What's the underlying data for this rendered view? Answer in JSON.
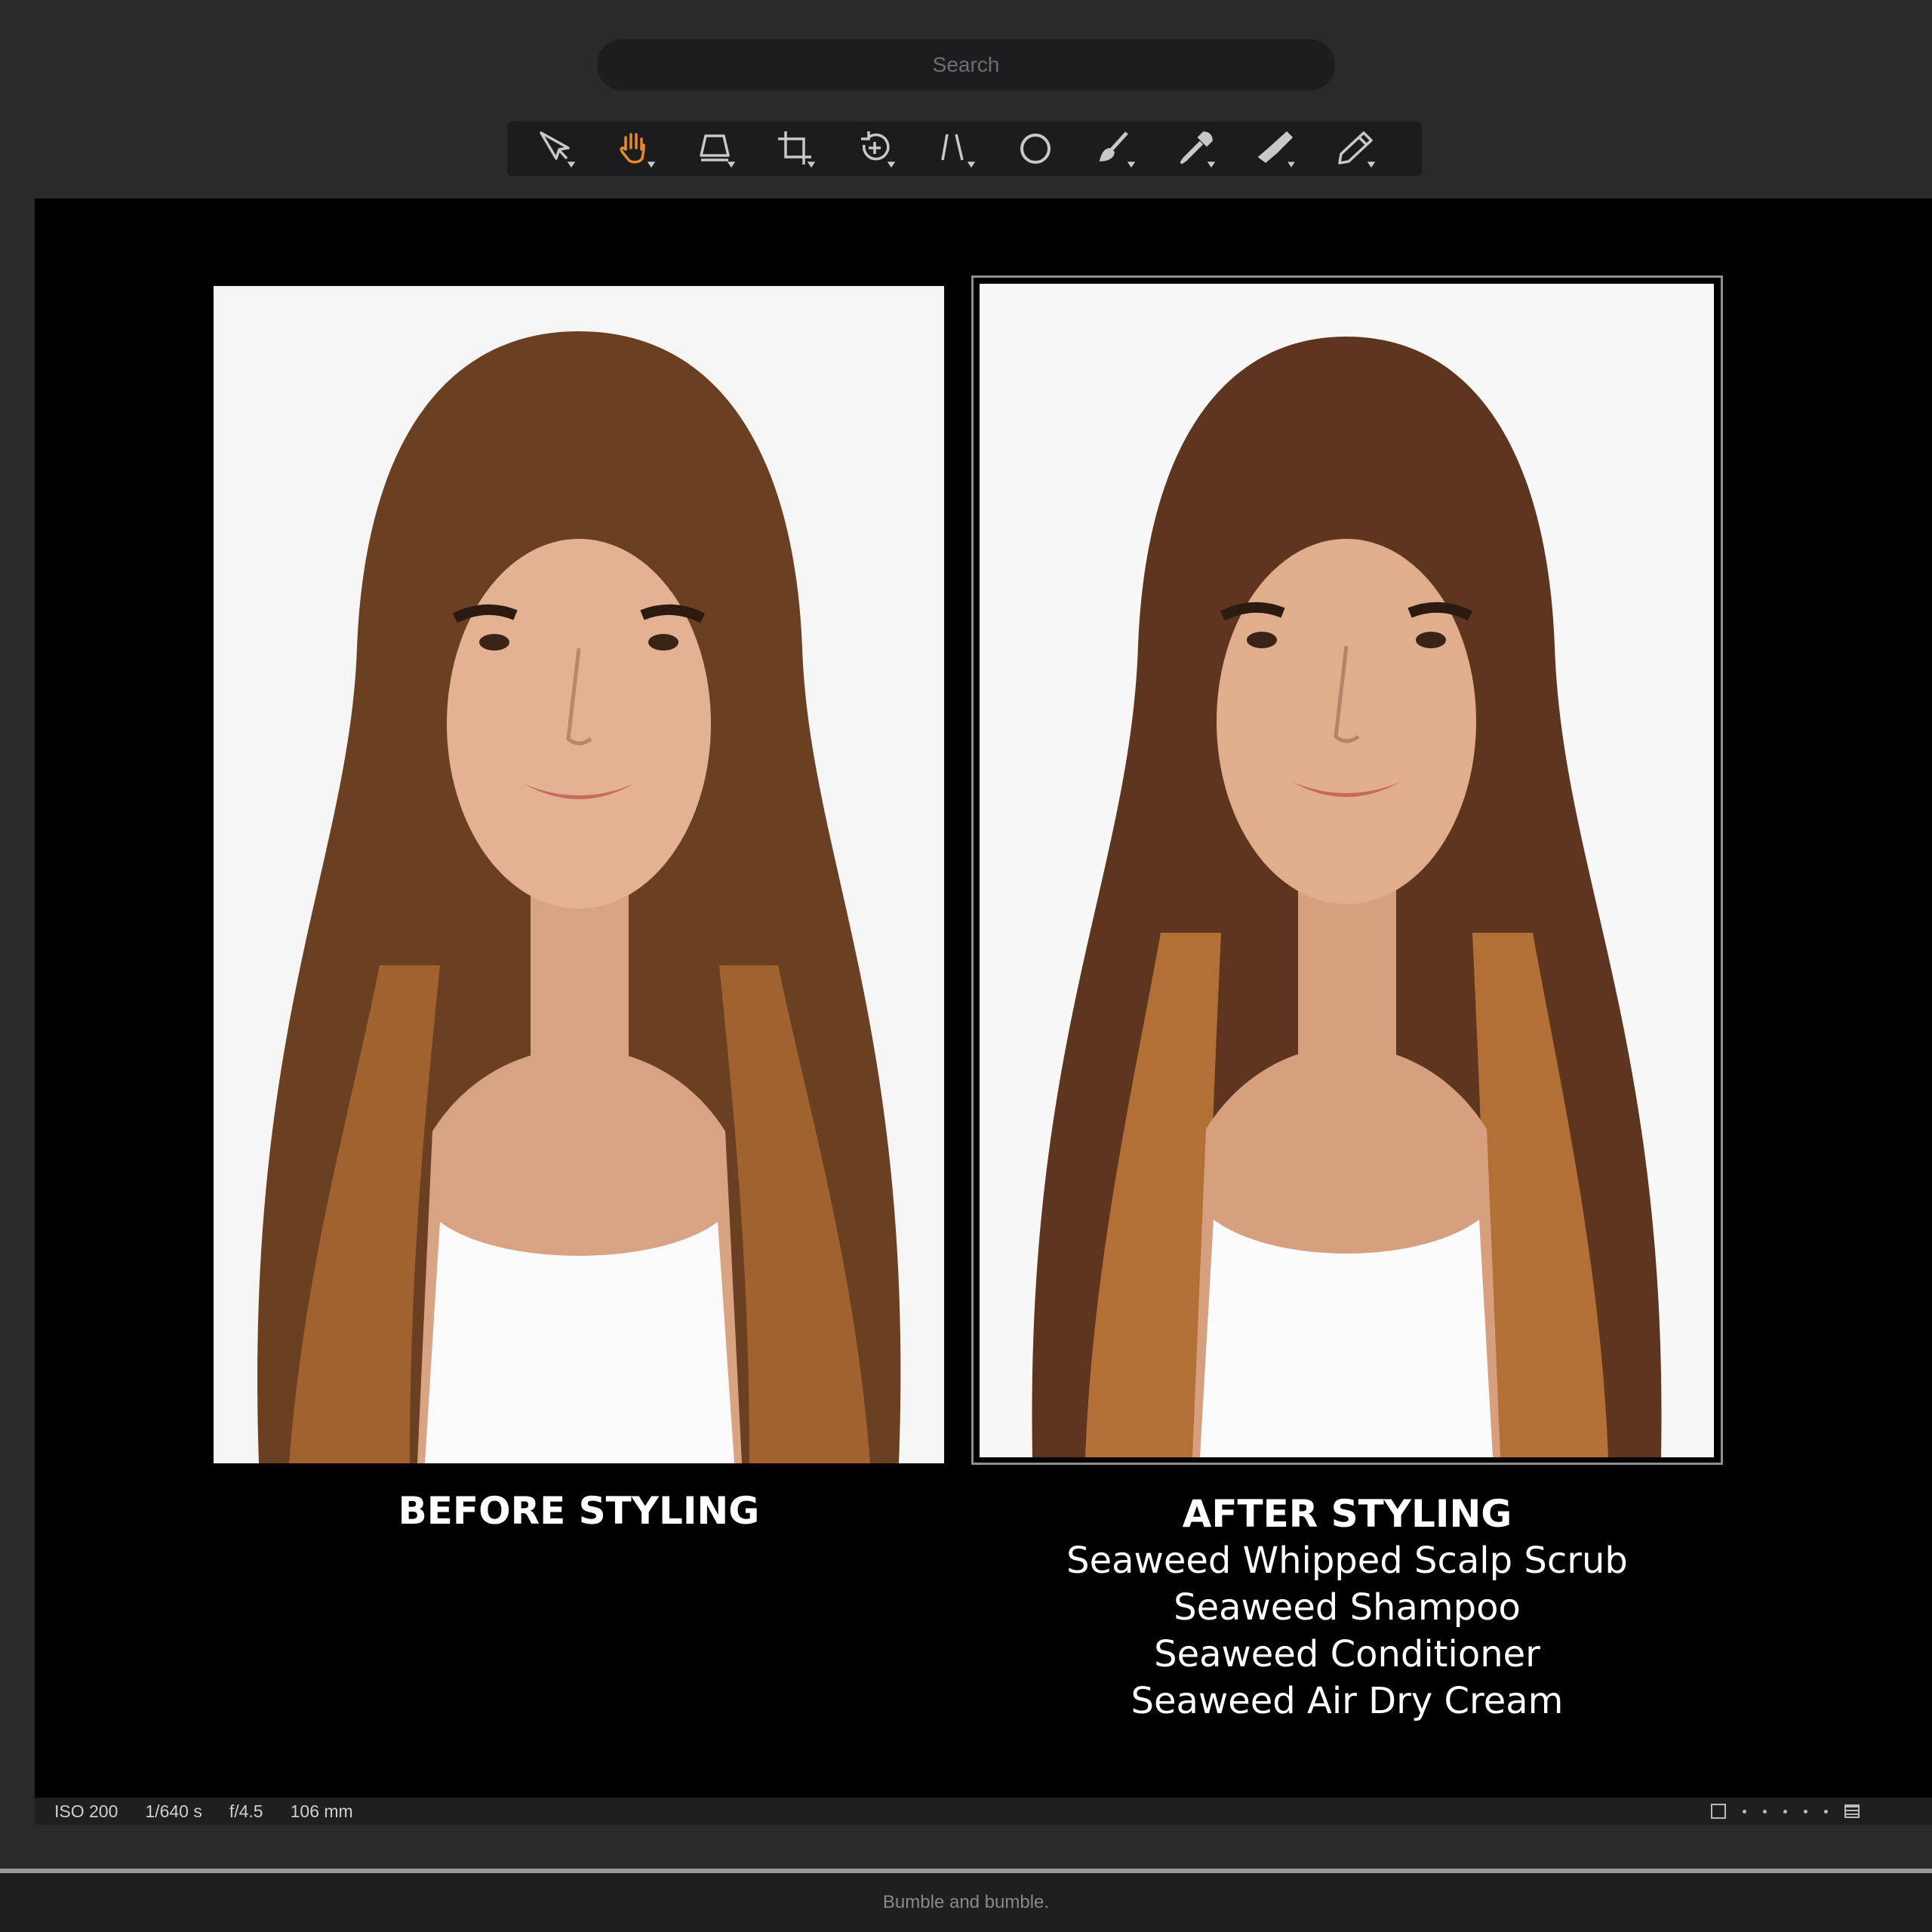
{
  "search": {
    "placeholder": "Search"
  },
  "toolbar": {
    "tools": [
      {
        "icon": "select-arrow-icon",
        "active": false
      },
      {
        "icon": "hand-pan-icon",
        "active": true
      },
      {
        "icon": "perspective-icon",
        "active": false
      },
      {
        "icon": "crop-icon",
        "active": false
      },
      {
        "icon": "rotate-icon",
        "active": false
      },
      {
        "icon": "straighten-icon",
        "active": false
      },
      {
        "icon": "circle-icon",
        "active": false
      },
      {
        "icon": "brush-icon",
        "active": false
      },
      {
        "icon": "eyedropper-icon",
        "active": false
      },
      {
        "icon": "clone-stamp-icon",
        "active": false
      },
      {
        "icon": "pencil-icon",
        "active": false
      }
    ],
    "active_color": "#e58a2e",
    "icon_color": "#c8c8c8"
  },
  "photos": {
    "before": {
      "caption": "BEFORE STYLING"
    },
    "after": {
      "caption": "AFTER STYLING",
      "products": [
        "Seaweed Whipped Scalp Scrub",
        "Seaweed Shampoo",
        "Seaweed Conditioner",
        "Seaweed Air Dry Cream"
      ]
    }
  },
  "status": {
    "iso": "ISO 200",
    "shutter": "1/640 s",
    "aperture": "f/4.5",
    "focal_length": "106 mm"
  },
  "footer": {
    "brand": "Bumble and bumble."
  }
}
